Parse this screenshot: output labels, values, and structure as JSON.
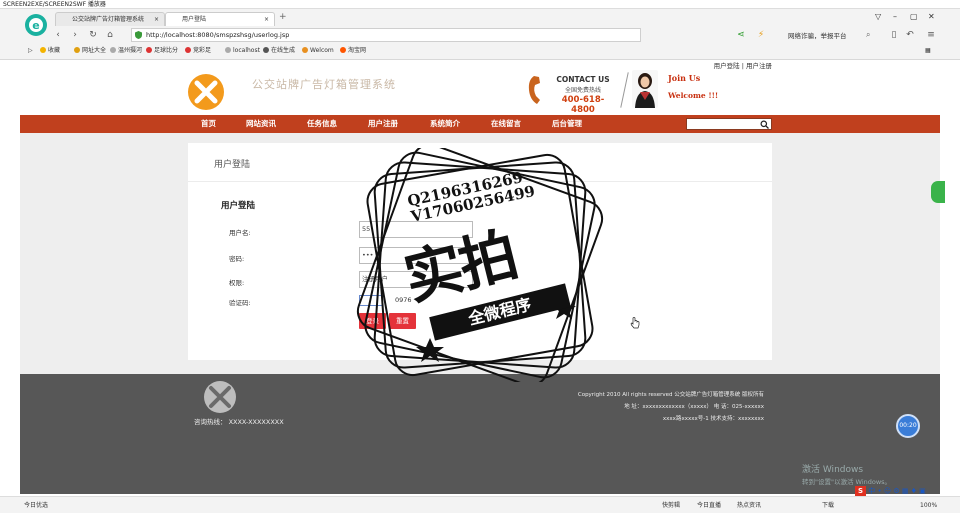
{
  "player": {
    "title": "SCREEN2EXE/SCREEN2SWF 播放器"
  },
  "browser": {
    "tabs": [
      {
        "label": "公交站牌广告灯箱管理系统"
      },
      {
        "label": "用户登陆"
      }
    ],
    "url": "http://localhost:8080/smspzshsg/userlog.jsp",
    "right_text": "网络诈骗，举报平台",
    "bookmarks": [
      "收藏",
      "网址大全",
      "温州摄河",
      "足球比分",
      "竞彩足",
      "localhost",
      "在线生成",
      "Welcom",
      "淘宝网"
    ]
  },
  "site": {
    "top_links": {
      "login": "用户登陆",
      "sep": "|",
      "register": "用户注册"
    },
    "title": "公交站牌广告灯箱管理系统",
    "contact": {
      "title": "CONTACT US",
      "sub": "全国免费热线",
      "phone": "400-618-4800"
    },
    "join": {
      "line1": "Join Us",
      "line2": "Welcome !!!"
    },
    "nav": [
      "首页",
      "网站资讯",
      "任务信息",
      "用户注册",
      "系统简介",
      "在线留言",
      "后台管理"
    ],
    "search": {
      "value": ""
    }
  },
  "login": {
    "header": "用户登陆",
    "title": "用户登陆",
    "fields": {
      "username": {
        "label": "用户名:",
        "value": "55"
      },
      "password": {
        "label": "密码:",
        "value": "•••"
      },
      "role": {
        "label": "权限:",
        "value": "注册用户"
      },
      "captcha": {
        "label": "验证码:",
        "value": "",
        "code": "0976"
      }
    },
    "buttons": {
      "submit": "登录",
      "reset": "重置"
    }
  },
  "footer": {
    "hotline": "咨询热线：  XXXX-XXXXXXXX",
    "copyright": "Copyright 2010 All rights reserved 公交站牌广告灯箱管理系统 版权所有",
    "address": "地   址：xxxxxxxxxxxxx（xxxxx） 电   话：025-xxxxxx",
    "tech": "xxxx路xxxxx号-1 技术支持：xxxxxxxx"
  },
  "watermark": {
    "qq_line1": "Q2196316269",
    "qq_line2": "V17060256499",
    "big": "实拍",
    "ribbon": "全微程序"
  },
  "overlay": {
    "timer": "00:20"
  },
  "windows": {
    "activate": "激活 Windows",
    "activate_sub": "转到\"设置\"以激活 Windows。"
  },
  "statusbar": {
    "left": "今日优选",
    "items": [
      "快剪辑",
      "今日直播",
      "热点资讯"
    ],
    "download": "下载",
    "zoom": "100%"
  },
  "ime": {
    "label": "中"
  },
  "colors": {
    "nav": "#c0401e",
    "footer": "#575757",
    "button": "#e4333a",
    "accent": "#d04010"
  }
}
